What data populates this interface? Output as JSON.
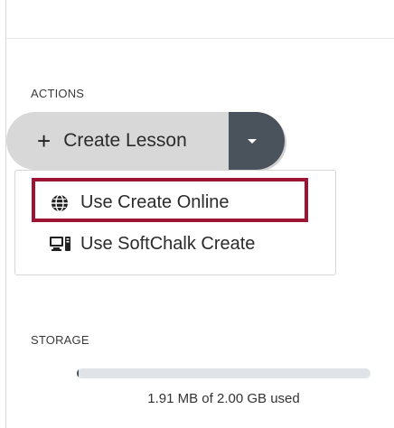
{
  "actions": {
    "section_label": "ACTIONS",
    "create_button": {
      "label": "Create Lesson",
      "icon": "plus-icon"
    },
    "dropdown_toggle": {
      "icon": "caret-down-icon"
    },
    "menu": {
      "items": [
        {
          "label": "Use Create Online",
          "icon": "globe-icon",
          "highlighted": true
        },
        {
          "label": "Use SoftChalk Create",
          "icon": "desktop-computer-icon",
          "highlighted": false
        }
      ]
    }
  },
  "storage": {
    "section_label": "STORAGE",
    "used_fraction": 0.001,
    "usage_text": "1.91 MB of 2.00 GB used"
  },
  "colors": {
    "button_bg": "#d8d8d8",
    "toggle_bg": "#4a525c",
    "highlight": "#9d1434",
    "bar_track": "#e0e4e9"
  }
}
